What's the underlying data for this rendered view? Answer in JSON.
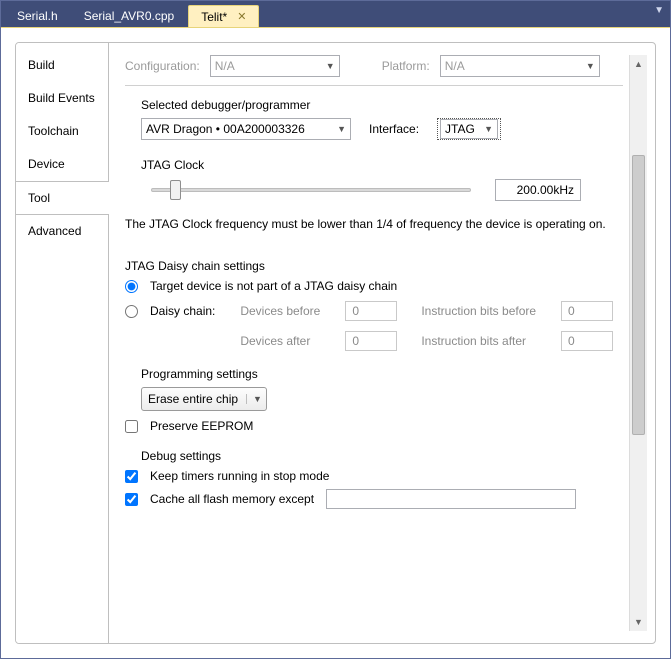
{
  "tabs": {
    "files": [
      "Serial.h",
      "Serial_AVR0.cpp",
      "Telit*"
    ],
    "active_index": 2
  },
  "top": {
    "configuration_label": "Configuration:",
    "configuration_value": "N/A",
    "platform_label": "Platform:",
    "platform_value": "N/A"
  },
  "sidetabs": [
    "Build",
    "Build Events",
    "Toolchain",
    "Device",
    "Tool",
    "Advanced"
  ],
  "sidetab_selected_index": 4,
  "debugger": {
    "section": "Selected debugger/programmer",
    "device": "AVR Dragon • 00A200003326",
    "interface_label": "Interface:",
    "interface_value": "JTAG"
  },
  "jtag_clock": {
    "section": "JTAG Clock",
    "value": "200.00kHz",
    "hint": "The JTAG Clock frequency must be lower than 1/4 of frequency the device is operating on."
  },
  "daisy": {
    "section": "JTAG Daisy chain settings",
    "opt_not_part": "Target device is not part of a JTAG daisy chain",
    "opt_chain": "Daisy chain:",
    "devices_before_label": "Devices before",
    "devices_before": "0",
    "instr_before_label": "Instruction bits before",
    "instr_before": "0",
    "devices_after_label": "Devices after",
    "devices_after": "0",
    "instr_after_label": "Instruction bits after",
    "instr_after": "0"
  },
  "programming": {
    "section": "Programming settings",
    "erase_mode": "Erase entire chip",
    "preserve_eeprom_label": "Preserve EEPROM",
    "preserve_eeprom": false
  },
  "debug": {
    "section": "Debug settings",
    "keep_timers_label": "Keep timers running in stop mode",
    "keep_timers": true,
    "cache_flash_label": "Cache all flash memory except",
    "cache_flash": true,
    "cache_except_value": ""
  }
}
